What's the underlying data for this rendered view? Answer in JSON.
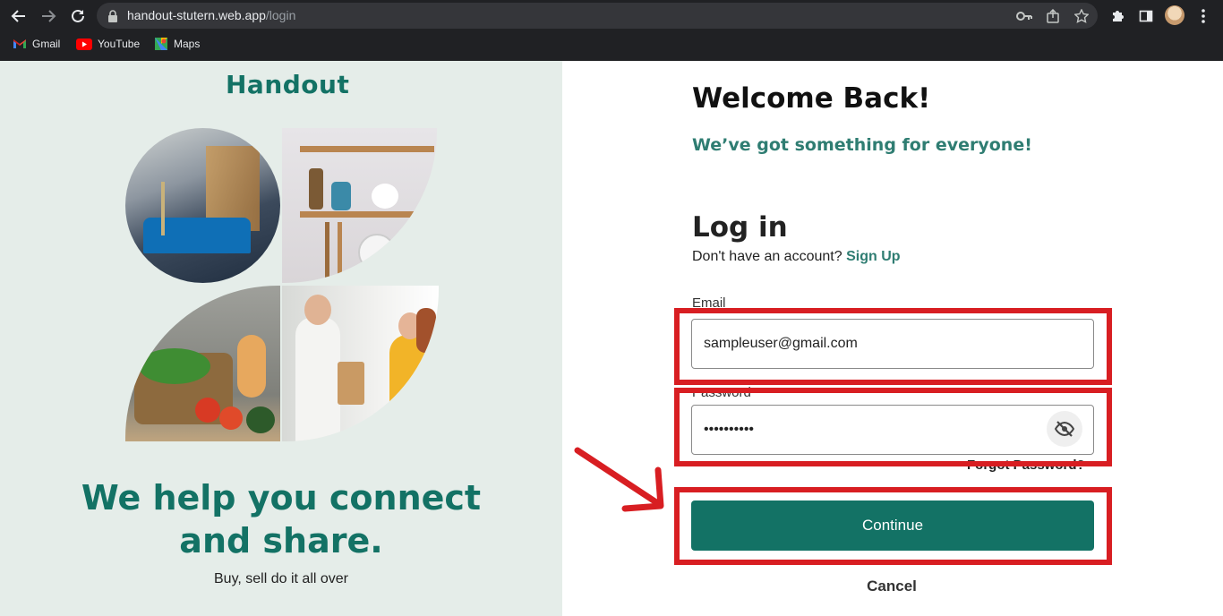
{
  "browser": {
    "url_host": "handout-stutern.web.app",
    "url_path": "/login",
    "bookmarks": [
      {
        "label": "Gmail",
        "icon": "gmail-icon"
      },
      {
        "label": "YouTube",
        "icon": "youtube-icon"
      },
      {
        "label": "Maps",
        "icon": "maps-icon"
      }
    ]
  },
  "left": {
    "logo": "Handout",
    "hero_title_line1": "We help you connect",
    "hero_title_line2": "and share.",
    "hero_subtitle": "Buy, sell do it all over"
  },
  "form": {
    "welcome": "Welcome Back!",
    "tagline": "We’ve got something for everyone!",
    "heading": "Log in",
    "no_account_text": "Don't have an account?",
    "signup_link": "Sign Up",
    "email_label": "Email",
    "email_value": "sampleuser@gmail.com",
    "password_label": "Password",
    "password_value": "••••••••••",
    "forgot_password": "Forgot Password?",
    "continue_label": "Continue",
    "cancel_label": "Cancel"
  },
  "colors": {
    "brand": "#137265",
    "accent_text": "#2f7d72",
    "left_bg": "#e5ede9",
    "annotation": "#d81e22"
  }
}
